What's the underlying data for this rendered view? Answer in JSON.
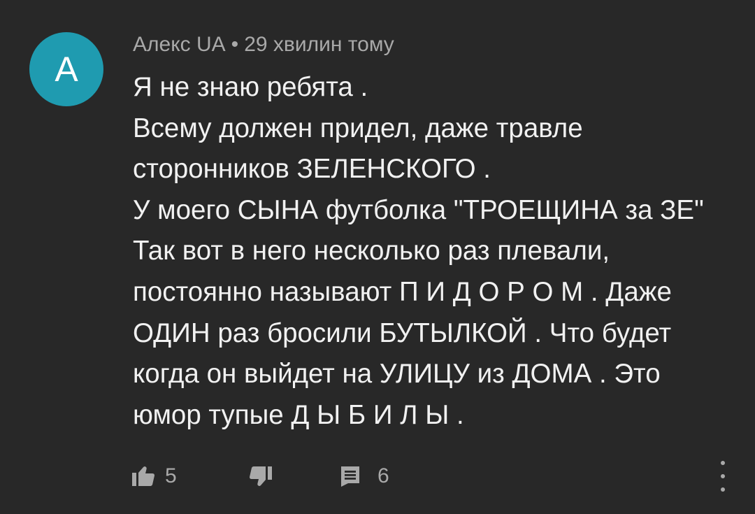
{
  "comment": {
    "avatar_letter": "A",
    "author": "Алекс UA",
    "separator": "•",
    "time": "29 хвилин тому",
    "lines": [
      "Я не знаю ребята .",
      "Всему должен придел, даже травле",
      "сторонников ЗЕЛЕНСКОГО .",
      "У моего СЫНА футболка \"ТРОЕЩИНА за ЗЕ\"",
      "Так вот в него несколько раз плевали,",
      "постоянно называют П И Д О Р О М . Даже",
      "ОДИН раз бросили БУТЫЛКОЙ . Что будет",
      "когда он выйдет на УЛИЦУ из ДОМА . Это",
      "юмор тупые Д Ы Б И Л Ы ."
    ],
    "likes": "5",
    "replies": "6"
  },
  "icons": {
    "like": "thumbs-up-icon",
    "dislike": "thumbs-down-icon",
    "reply": "reply-icon",
    "more": "more-vert-icon"
  },
  "colors": {
    "background": "#282828",
    "avatar": "#1f9bb0",
    "text": "#f1f1f1",
    "muted": "#a9a9a9"
  }
}
